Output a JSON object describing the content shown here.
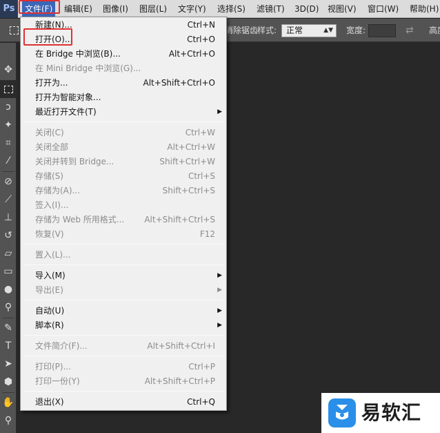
{
  "app": {
    "logo": "Ps"
  },
  "menubar": {
    "items": [
      "文件(F)",
      "编辑(E)",
      "图像(I)",
      "图层(L)",
      "文字(Y)",
      "选择(S)",
      "滤镜(T)",
      "3D(D)",
      "视图(V)",
      "窗口(W)",
      "帮助(H)"
    ],
    "active": "文件(F)"
  },
  "options_bar": {
    "mode_label": "消除锯齿",
    "style_label": "样式:",
    "style_value": "正常",
    "width_label": "宽度:",
    "height_label": "高度"
  },
  "toolbar": {
    "tools": [
      "move-icon",
      "rect-marquee-icon",
      "lasso-icon",
      "magic-wand-icon",
      "crop-icon",
      "eyedropper-icon",
      "healing-brush-icon",
      "brush-icon",
      "clone-stamp-icon",
      "history-brush-icon",
      "eraser-icon",
      "gradient-icon",
      "blur-icon",
      "dodge-icon",
      "pen-icon",
      "type-icon",
      "path-select-icon",
      "shape-icon",
      "hand-icon",
      "zoom-icon"
    ],
    "selected": "rect-marquee-icon"
  },
  "file_menu": {
    "groups": [
      [
        {
          "label": "新建(N)...",
          "shortcut": "Ctrl+N",
          "enabled": true
        },
        {
          "label": "打开(O)...",
          "shortcut": "Ctrl+O",
          "enabled": true,
          "highlighted": true
        },
        {
          "label": "在 Bridge 中浏览(B)...",
          "shortcut": "Alt+Ctrl+O",
          "enabled": true
        },
        {
          "label": "在 Mini Bridge 中浏览(G)...",
          "shortcut": "",
          "enabled": false
        },
        {
          "label": "打开为...",
          "shortcut": "Alt+Shift+Ctrl+O",
          "enabled": true
        },
        {
          "label": "打开为智能对象...",
          "shortcut": "",
          "enabled": true
        },
        {
          "label": "最近打开文件(T)",
          "shortcut": "",
          "enabled": true,
          "submenu": true
        }
      ],
      [
        {
          "label": "关闭(C)",
          "shortcut": "Ctrl+W",
          "enabled": false
        },
        {
          "label": "关闭全部",
          "shortcut": "Alt+Ctrl+W",
          "enabled": false
        },
        {
          "label": "关闭并转到 Bridge...",
          "shortcut": "Shift+Ctrl+W",
          "enabled": false
        },
        {
          "label": "存储(S)",
          "shortcut": "Ctrl+S",
          "enabled": false
        },
        {
          "label": "存储为(A)...",
          "shortcut": "Shift+Ctrl+S",
          "enabled": false
        },
        {
          "label": "签入(I)...",
          "shortcut": "",
          "enabled": false
        },
        {
          "label": "存储为 Web 所用格式...",
          "shortcut": "Alt+Shift+Ctrl+S",
          "enabled": false
        },
        {
          "label": "恢复(V)",
          "shortcut": "F12",
          "enabled": false
        }
      ],
      [
        {
          "label": "置入(L)...",
          "shortcut": "",
          "enabled": false
        }
      ],
      [
        {
          "label": "导入(M)",
          "shortcut": "",
          "enabled": true,
          "submenu": true
        },
        {
          "label": "导出(E)",
          "shortcut": "",
          "enabled": false,
          "submenu": true
        }
      ],
      [
        {
          "label": "自动(U)",
          "shortcut": "",
          "enabled": true,
          "submenu": true
        },
        {
          "label": "脚本(R)",
          "shortcut": "",
          "enabled": true,
          "submenu": true
        }
      ],
      [
        {
          "label": "文件简介(F)...",
          "shortcut": "Alt+Shift+Ctrl+I",
          "enabled": false
        }
      ],
      [
        {
          "label": "打印(P)...",
          "shortcut": "Ctrl+P",
          "enabled": false
        },
        {
          "label": "打印一份(Y)",
          "shortcut": "Alt+Shift+Ctrl+P",
          "enabled": false
        }
      ],
      [
        {
          "label": "退出(X)",
          "shortcut": "Ctrl+Q",
          "enabled": true
        }
      ]
    ]
  },
  "watermark": {
    "text": "易软汇",
    "icon": "brand-logo-icon"
  },
  "colors": {
    "menu_active": "#3c66b8",
    "highlight_box": "#e03030",
    "canvas": "#282828",
    "panel": "#535353",
    "brand": "#2a8fe8"
  }
}
